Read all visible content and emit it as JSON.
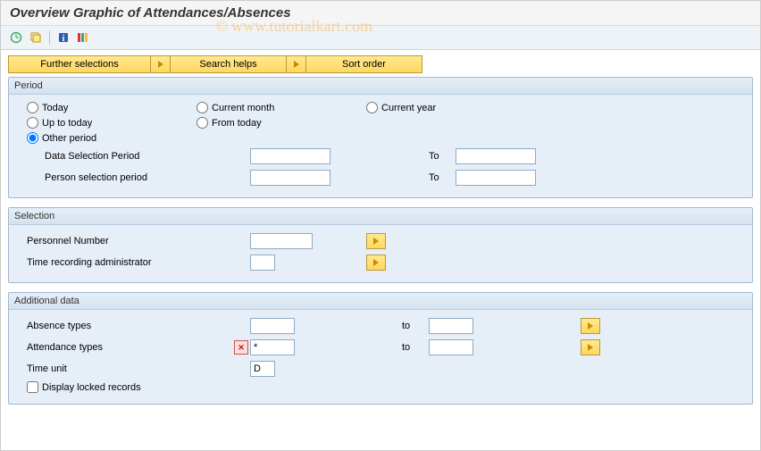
{
  "title": "Overview Graphic of Attendances/Absences",
  "watermark": "© www.tutorialkart.com",
  "toolbar": {
    "execute": "execute",
    "variant": "get-variant",
    "info": "information",
    "legend": "legend"
  },
  "buttons": {
    "further": "Further selections",
    "search": "Search helps",
    "sort": "Sort order"
  },
  "period": {
    "title": "Period",
    "radios": {
      "today": "Today",
      "current_month": "Current month",
      "current_year": "Current year",
      "up_to_today": "Up to today",
      "from_today": "From today",
      "other": "Other period"
    },
    "selected": "other",
    "data_sel_label": "Data Selection Period",
    "person_sel_label": "Person selection period",
    "to_label": "To",
    "data_from": "",
    "data_to": "",
    "person_from": "",
    "person_to": ""
  },
  "selection": {
    "title": "Selection",
    "pernr_label": "Personnel Number",
    "pernr_value": "",
    "timeadmin_label": "Time recording administrator",
    "timeadmin_value": ""
  },
  "additional": {
    "title": "Additional data",
    "absence_label": "Absence types",
    "absence_from": "",
    "absence_to": "",
    "attendance_label": "Attendance types",
    "attendance_from": "*",
    "attendance_to": "",
    "attendance_error": true,
    "to_label": "to",
    "timeunit_label": "Time unit",
    "timeunit_value": "D",
    "display_locked_label": "Display locked records",
    "display_locked_checked": false
  }
}
